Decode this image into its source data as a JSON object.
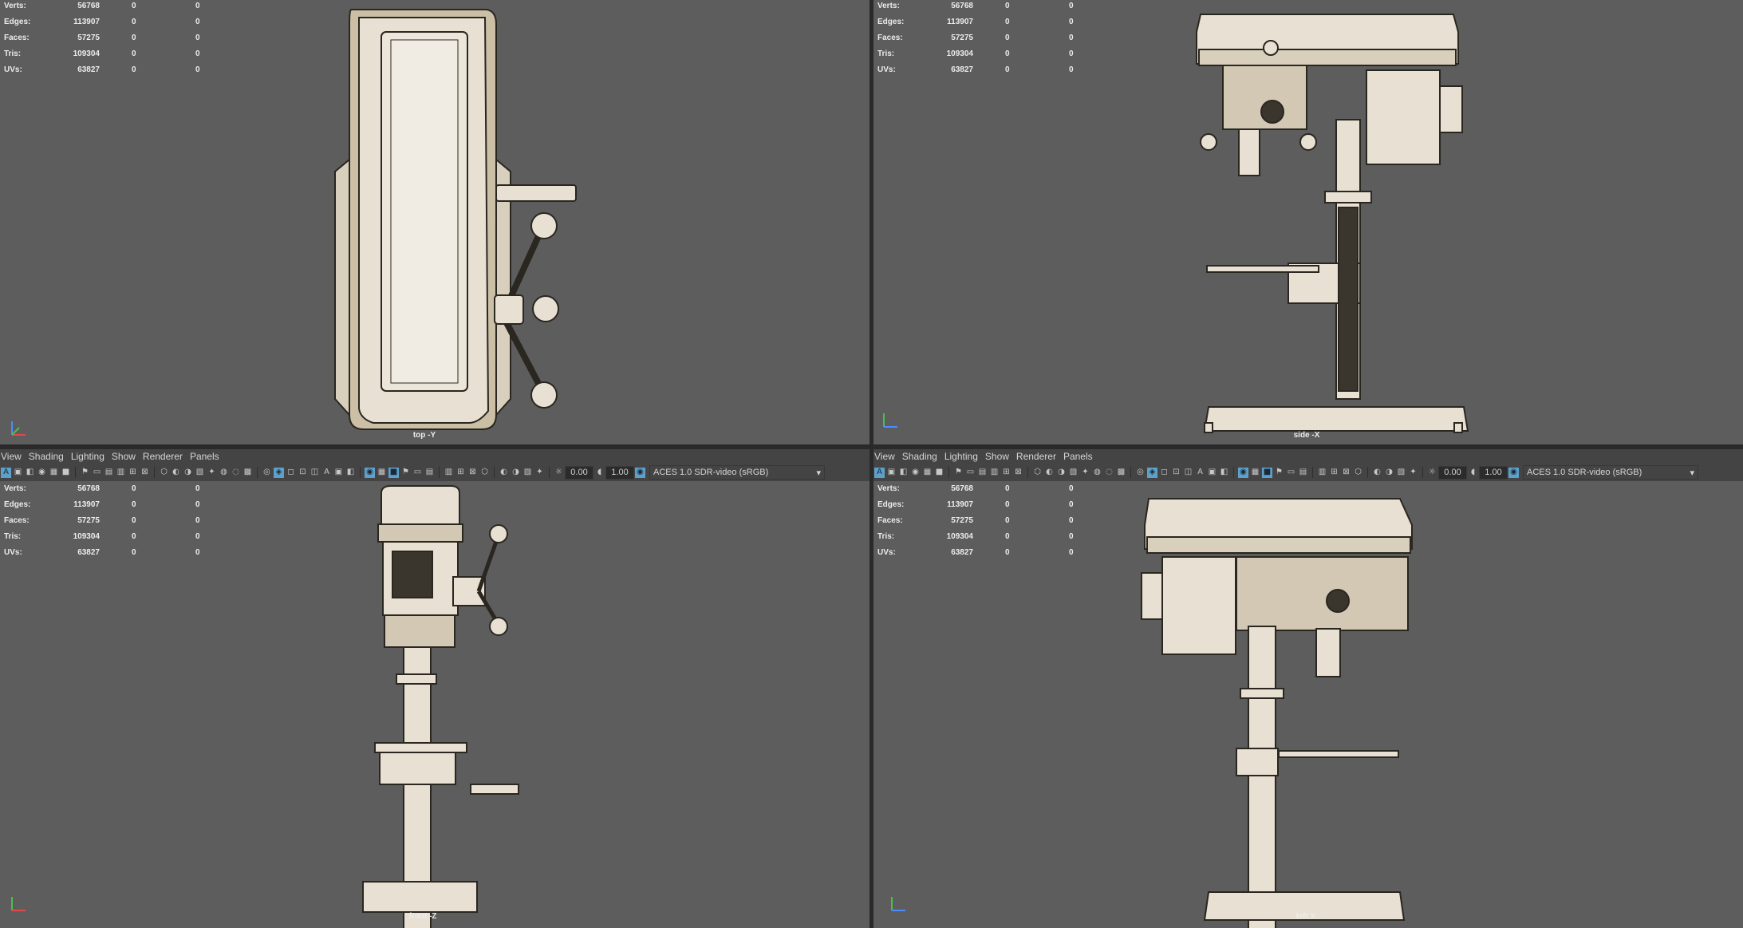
{
  "hud": {
    "rows": [
      {
        "label": "Verts:",
        "value": "56768",
        "sel": "0",
        "comp": "0"
      },
      {
        "label": "Edges:",
        "value": "113907",
        "sel": "0",
        "comp": "0"
      },
      {
        "label": "Faces:",
        "value": "57275",
        "sel": "0",
        "comp": "0"
      },
      {
        "label": "Tris:",
        "value": "109304",
        "sel": "0",
        "comp": "0"
      },
      {
        "label": "UVs:",
        "value": "63827",
        "sel": "0",
        "comp": "0"
      }
    ]
  },
  "panel_menu": [
    "View",
    "Shading",
    "Lighting",
    "Show",
    "Renderer",
    "Panels"
  ],
  "toolbar": {
    "exposure": "0.00",
    "gamma": "1.00",
    "color_space": "ACES 1.0 SDR-video (sRGB)"
  },
  "views": {
    "top": "top -Y",
    "side": "side -X",
    "front": "front -Z",
    "left": "left X"
  },
  "colors": {
    "viewport_bg": "#5d5d5d",
    "model_fill": "#e8e0d2",
    "wire": "#2a2620",
    "toolbar_bg": "#444444",
    "highlight": "#5da0c9"
  },
  "icons": [
    "select-camera-icon",
    "camera-attributes-icon",
    "bookmark-icon",
    "image-plane-icon",
    "grid-icon",
    "film-gate-icon",
    "resolution-gate-icon",
    "gate-mask-icon",
    "field-chart-icon",
    "safe-action-icon",
    "safe-title-icon",
    "wireframe-icon",
    "smooth-shade-icon",
    "wireframe-on-shaded-icon",
    "textured-icon",
    "lights-icon",
    "shadows-icon",
    "ambient-occlusion-icon",
    "motion-blur-icon",
    "anti-aliasing-icon",
    "depth-of-field-icon",
    "isolate-select-icon",
    "xray-icon",
    "xray-joints-icon",
    "backface-icon",
    "exposure-icon",
    "gamma-icon",
    "color-management-icon"
  ]
}
